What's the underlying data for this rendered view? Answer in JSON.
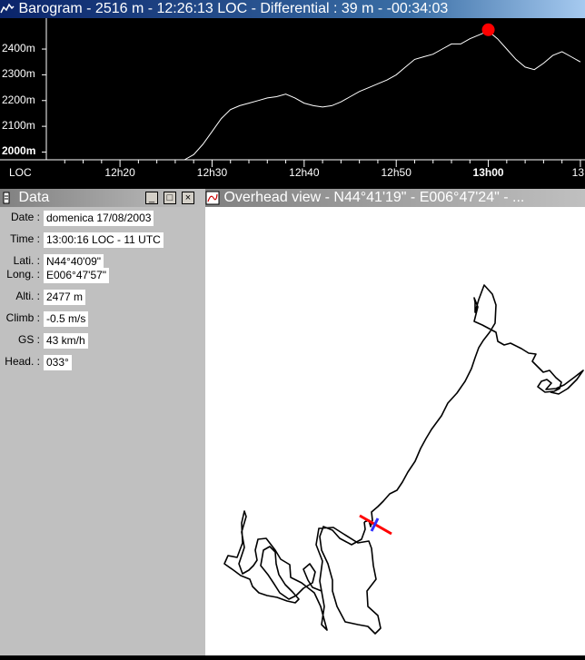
{
  "barogram": {
    "title": "Barogram  -  2516 m  -  12:26:13 LOC  -  Differential : 39 m  -  -00:34:03",
    "y_ticks": [
      "2400m",
      "2300m",
      "2200m",
      "2100m",
      "2000m"
    ],
    "y_values": [
      2400,
      2300,
      2200,
      2100,
      2000
    ],
    "x_ticks": [
      "12h20",
      "12h30",
      "12h40",
      "12h50",
      "13h00",
      "13"
    ],
    "x_axis_label": "LOC",
    "ymin": 1970,
    "ymax": 2520,
    "xmin_minutes": 12,
    "xmax_minutes": 70.5,
    "trace_color": "#ffffff",
    "marker_color": "#ff0000",
    "profile": [
      [
        27,
        1970
      ],
      [
        28,
        1990
      ],
      [
        29,
        2030
      ],
      [
        30,
        2080
      ],
      [
        31,
        2130
      ],
      [
        32,
        2165
      ],
      [
        33,
        2180
      ],
      [
        34,
        2190
      ],
      [
        35,
        2200
      ],
      [
        36,
        2210
      ],
      [
        37,
        2215
      ],
      [
        38,
        2225
      ],
      [
        39,
        2210
      ],
      [
        40,
        2190
      ],
      [
        41,
        2180
      ],
      [
        42,
        2175
      ],
      [
        43,
        2180
      ],
      [
        44,
        2195
      ],
      [
        45,
        2215
      ],
      [
        46,
        2235
      ],
      [
        47,
        2250
      ],
      [
        48,
        2265
      ],
      [
        49,
        2280
      ],
      [
        50,
        2300
      ],
      [
        51,
        2330
      ],
      [
        52,
        2360
      ],
      [
        53,
        2370
      ],
      [
        54,
        2380
      ],
      [
        55,
        2400
      ],
      [
        56,
        2420
      ],
      [
        57,
        2420
      ],
      [
        58,
        2440
      ],
      [
        59,
        2455
      ],
      [
        60,
        2470
      ],
      [
        61,
        2440
      ],
      [
        62,
        2400
      ],
      [
        63,
        2360
      ],
      [
        64,
        2330
      ],
      [
        65,
        2320
      ],
      [
        66,
        2345
      ],
      [
        67,
        2375
      ],
      [
        68,
        2390
      ],
      [
        69,
        2370
      ],
      [
        70,
        2350
      ]
    ],
    "marker": [
      60.0,
      2475
    ]
  },
  "data_panel": {
    "title": "Data",
    "fields": [
      {
        "label": "Date :",
        "value": "domenica 17/08/2003"
      },
      {
        "label": "Time :",
        "value": "13:00:16 LOC  -  11 UTC"
      },
      {
        "label": "Lati. :",
        "value": "N44°40'09\""
      },
      {
        "label": "Long. :",
        "value": "E006°47'57\""
      },
      {
        "label": "Alti. :",
        "value": "2477 m"
      },
      {
        "label": "Climb :",
        "value": "-0.5 m/s"
      },
      {
        "label": "GS :",
        "value": "43 km/h"
      },
      {
        "label": "Head. :",
        "value": "033°"
      }
    ],
    "buttons": {
      "minimize": "_",
      "maximize": "□",
      "close": "×"
    }
  },
  "overhead": {
    "title": "Overhead view  -  N44°41'19\"  -  E006°47'24\"  - ...",
    "track_color": "#000000",
    "glider_colors": [
      "#ff0000",
      "#3030ff"
    ]
  }
}
